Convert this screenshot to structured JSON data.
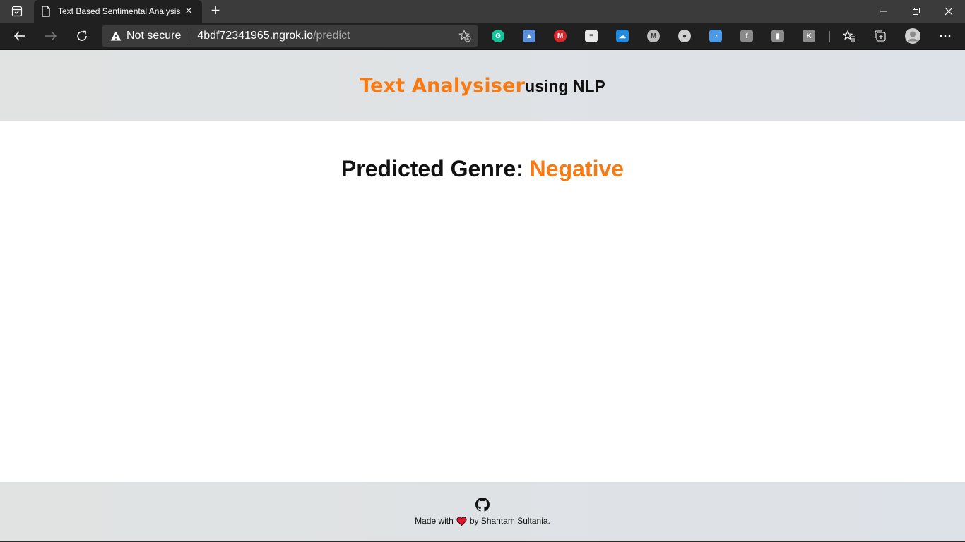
{
  "browser": {
    "tab": {
      "title": "Text Based Sentimental Analysis",
      "close_label": "×"
    },
    "new_tab_label": "+",
    "address": {
      "security_label": "Not secure",
      "host": "4bdf72341965.ngrok.io",
      "path": "/predict"
    },
    "extensions": [
      {
        "name": "grammarly",
        "glyph": "G",
        "color": "#15c39a"
      },
      {
        "name": "cloud-upload",
        "glyph": "▲",
        "color": "#5b8fd9"
      },
      {
        "name": "mega",
        "glyph": "M",
        "color": "#d9272e"
      },
      {
        "name": "notion-like",
        "glyph": "≡",
        "color": "#e8e8e8"
      },
      {
        "name": "onedrive",
        "glyph": "☁",
        "color": "#1e8be0"
      },
      {
        "name": "ext-circle",
        "glyph": "M",
        "color": "#bcbcbc"
      },
      {
        "name": "ext-record",
        "glyph": "●",
        "color": "#d0d0d0"
      },
      {
        "name": "ext-rainbow",
        "glyph": "◔",
        "color": "#4c9be8"
      },
      {
        "name": "facebook",
        "glyph": "f",
        "color": "#8a8a8a"
      },
      {
        "name": "ext-chart",
        "glyph": "▮",
        "color": "#8a8a8a"
      },
      {
        "name": "ext-k",
        "glyph": "K",
        "color": "#8a8a8a"
      }
    ]
  },
  "header": {
    "brand_name": "Text Analysiser",
    "brand_suffix": "using NLP"
  },
  "result": {
    "label": "Predicted Genre: ",
    "value": "Negative"
  },
  "footer": {
    "made_with": "Made with",
    "by_text": "by Shantam Sultania."
  },
  "colors": {
    "accent": "#f97a11",
    "heart": "#e3122d"
  }
}
